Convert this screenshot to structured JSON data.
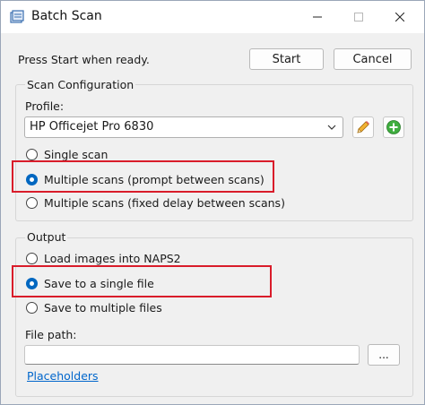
{
  "window": {
    "title": "Batch Scan"
  },
  "status_text": "Press Start when ready.",
  "buttons": {
    "start": "Start",
    "cancel": "Cancel",
    "browse": "..."
  },
  "scan_config": {
    "legend": "Scan Configuration",
    "profile_label": "Profile:",
    "profile_value": "HP Officejet Pro 6830",
    "options": [
      {
        "label": "Single scan",
        "checked": false
      },
      {
        "label": "Multiple scans (prompt between scans)",
        "checked": true
      },
      {
        "label": "Multiple scans (fixed delay between scans)",
        "checked": false
      }
    ]
  },
  "output": {
    "legend": "Output",
    "options": [
      {
        "label": "Load images into NAPS2",
        "checked": false
      },
      {
        "label": "Save to a single file",
        "checked": true
      },
      {
        "label": "Save to multiple files",
        "checked": false
      }
    ],
    "file_path_label": "File path:",
    "file_path_value": "",
    "placeholders_link": "Placeholders"
  },
  "colors": {
    "accent": "#0067c0",
    "highlight": "#d91c2a",
    "link": "#0066cc"
  },
  "icons": [
    "app-icon",
    "minimize-icon",
    "maximize-icon",
    "close-icon",
    "chevron-down-icon",
    "pencil-icon",
    "add-icon"
  ]
}
